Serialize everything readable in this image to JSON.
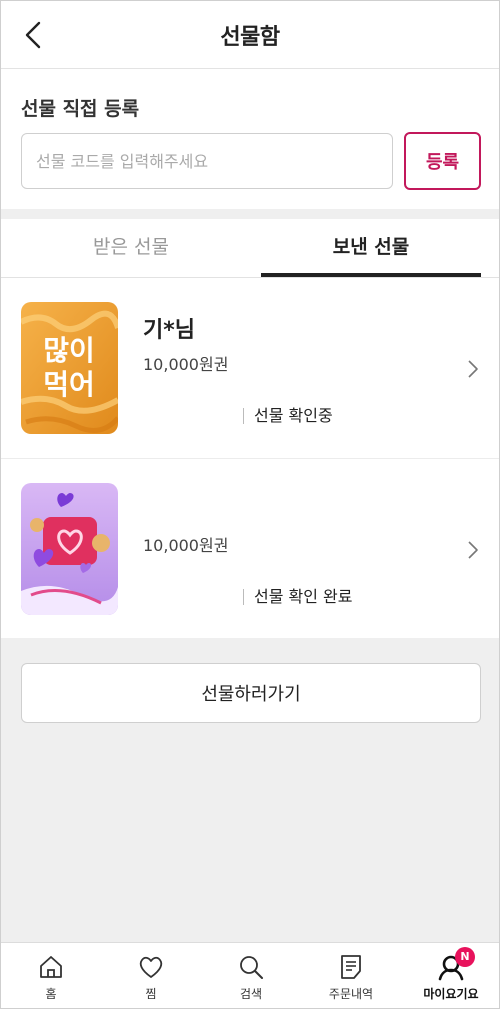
{
  "header": {
    "title": "선물함"
  },
  "register": {
    "title": "선물 직접 등록",
    "placeholder": "선물 코드를 입력해주세요",
    "button_label": "등록"
  },
  "tabs": [
    {
      "label": "받은 선물",
      "active": false
    },
    {
      "label": "보낸 선물",
      "active": true
    }
  ],
  "gifts": [
    {
      "recipient": "기*님",
      "amount": "10,000원권",
      "status": "선물 확인중",
      "thumb_text_1": "많이",
      "thumb_text_2": "먹어"
    },
    {
      "recipient": "",
      "amount": "10,000원권",
      "status": "선물 확인 완료"
    }
  ],
  "go_button_label": "선물하러가기",
  "bottom_nav": [
    {
      "label": "홈",
      "icon": "home-icon"
    },
    {
      "label": "찜",
      "icon": "heart-icon"
    },
    {
      "label": "검색",
      "icon": "search-icon"
    },
    {
      "label": "주문내역",
      "icon": "receipt-icon"
    },
    {
      "label": "마이요기요",
      "icon": "my-page-icon",
      "badge": "N",
      "active": true
    }
  ],
  "colors": {
    "accent": "#c2185b",
    "badge": "#e8125c"
  }
}
